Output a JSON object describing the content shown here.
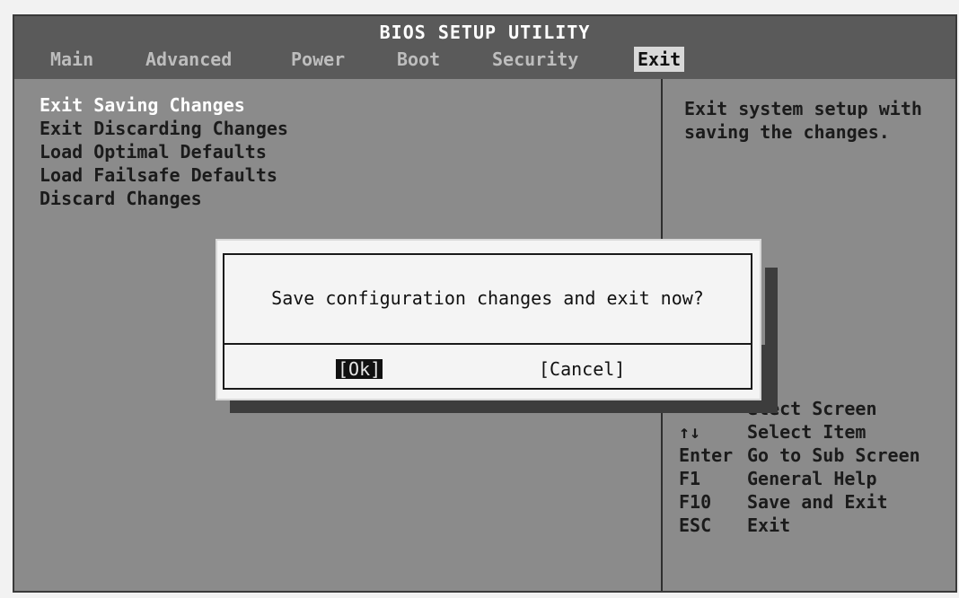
{
  "header": {
    "title": "BIOS SETUP UTILITY",
    "tabs": [
      "Main",
      "Advanced",
      "Power",
      "Boot",
      "Security",
      "Exit"
    ],
    "active_tab": "Exit"
  },
  "menu": {
    "items": [
      "Exit Saving Changes",
      "Exit Discarding Changes",
      "Load Optimal Defaults",
      "Load Failsafe Defaults",
      "Discard Changes"
    ],
    "selected": "Exit Saving Changes"
  },
  "help": {
    "description": "Exit system setup with saving the changes."
  },
  "keys": [
    {
      "key": "",
      "action": "elect Screen"
    },
    {
      "key": "↑↓",
      "action": "Select Item"
    },
    {
      "key": "Enter",
      "action": "Go to Sub Screen"
    },
    {
      "key": "F1",
      "action": "General Help"
    },
    {
      "key": "F10",
      "action": "Save and Exit"
    },
    {
      "key": "ESC",
      "action": "Exit"
    }
  ],
  "dialog": {
    "message": "Save configuration changes and exit now?",
    "ok_label": "[Ok]",
    "cancel_label": "[Cancel]"
  },
  "colors": {
    "background": "#8b8b8b",
    "header": "#5a5a5a",
    "dialog": "#f4f4f4",
    "highlight": "#111111"
  }
}
